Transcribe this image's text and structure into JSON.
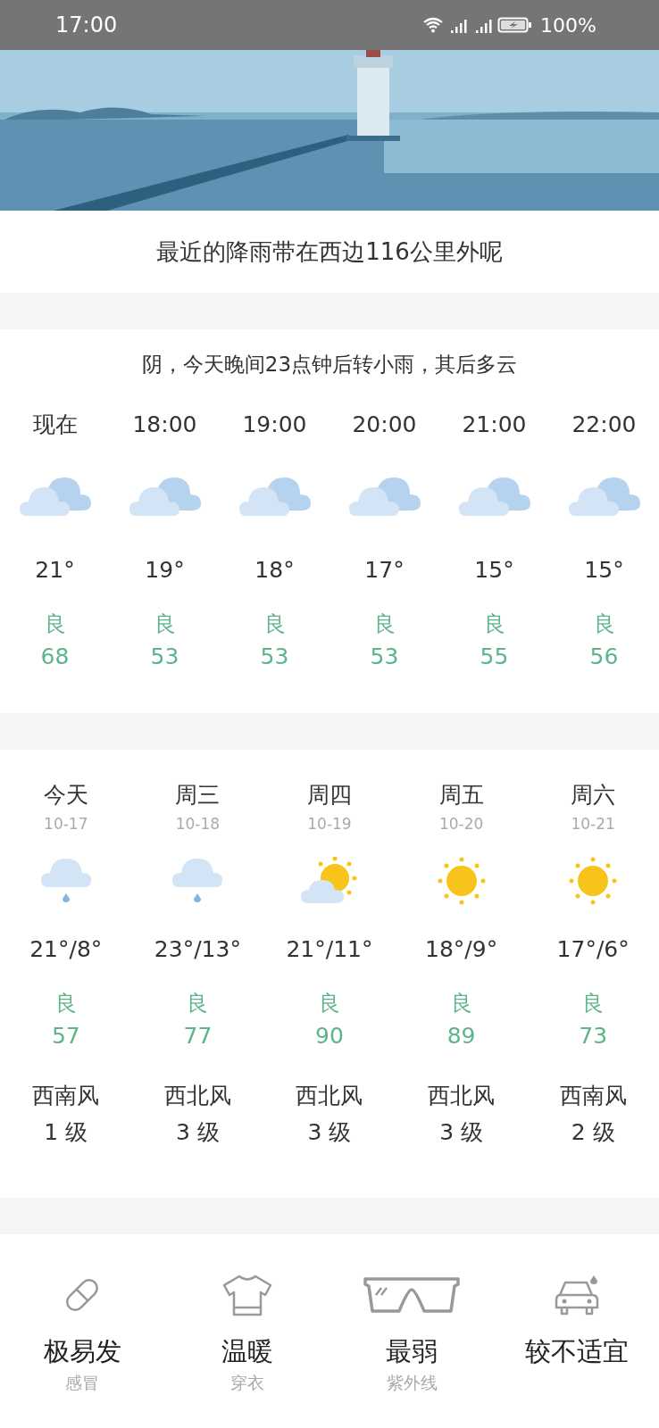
{
  "status_bar": {
    "time": "17:00",
    "battery": "100%"
  },
  "rain_notice": "最近的降雨带在西边116公里外呢",
  "hourly": {
    "summary": "阴，今天晚间23点钟后转小雨，其后多云",
    "hours": [
      {
        "time": "现在",
        "kind": "cloudy",
        "temp": "21°",
        "aqi_label": "良",
        "aqi": "68"
      },
      {
        "time": "18:00",
        "kind": "cloudy",
        "temp": "19°",
        "aqi_label": "良",
        "aqi": "53"
      },
      {
        "time": "19:00",
        "kind": "cloudy",
        "temp": "18°",
        "aqi_label": "良",
        "aqi": "53"
      },
      {
        "time": "20:00",
        "kind": "cloudy",
        "temp": "17°",
        "aqi_label": "良",
        "aqi": "53"
      },
      {
        "time": "21:00",
        "kind": "cloudy",
        "temp": "15°",
        "aqi_label": "良",
        "aqi": "55"
      },
      {
        "time": "22:00",
        "kind": "cloudy",
        "temp": "15°",
        "aqi_label": "良",
        "aqi": "56"
      }
    ]
  },
  "daily": [
    {
      "day": "今天",
      "date": "10-17",
      "kind": "rain",
      "temp": "21°/8°",
      "aqi_label": "良",
      "aqi": "57",
      "wind": "西南风",
      "wind_level": "1 级"
    },
    {
      "day": "周三",
      "date": "10-18",
      "kind": "rain",
      "temp": "23°/13°",
      "aqi_label": "良",
      "aqi": "77",
      "wind": "西北风",
      "wind_level": "3 级"
    },
    {
      "day": "周四",
      "date": "10-19",
      "kind": "partly_sunny",
      "temp": "21°/11°",
      "aqi_label": "良",
      "aqi": "90",
      "wind": "西北风",
      "wind_level": "3 级"
    },
    {
      "day": "周五",
      "date": "10-20",
      "kind": "sunny",
      "temp": "18°/9°",
      "aqi_label": "良",
      "aqi": "89",
      "wind": "西北风",
      "wind_level": "3 级"
    },
    {
      "day": "周六",
      "date": "10-21",
      "kind": "sunny",
      "temp": "17°/6°",
      "aqi_label": "良",
      "aqi": "73",
      "wind": "西南风",
      "wind_level": "2 级"
    }
  ],
  "indices": [
    {
      "kind": "pill",
      "value": "极易发",
      "label": "感冒"
    },
    {
      "kind": "shirt",
      "value": "温暖",
      "label": "穿衣"
    },
    {
      "kind": "glasses",
      "value": "最弱",
      "label": "紫外线"
    },
    {
      "kind": "car",
      "value": "较不适宜"
    }
  ]
}
